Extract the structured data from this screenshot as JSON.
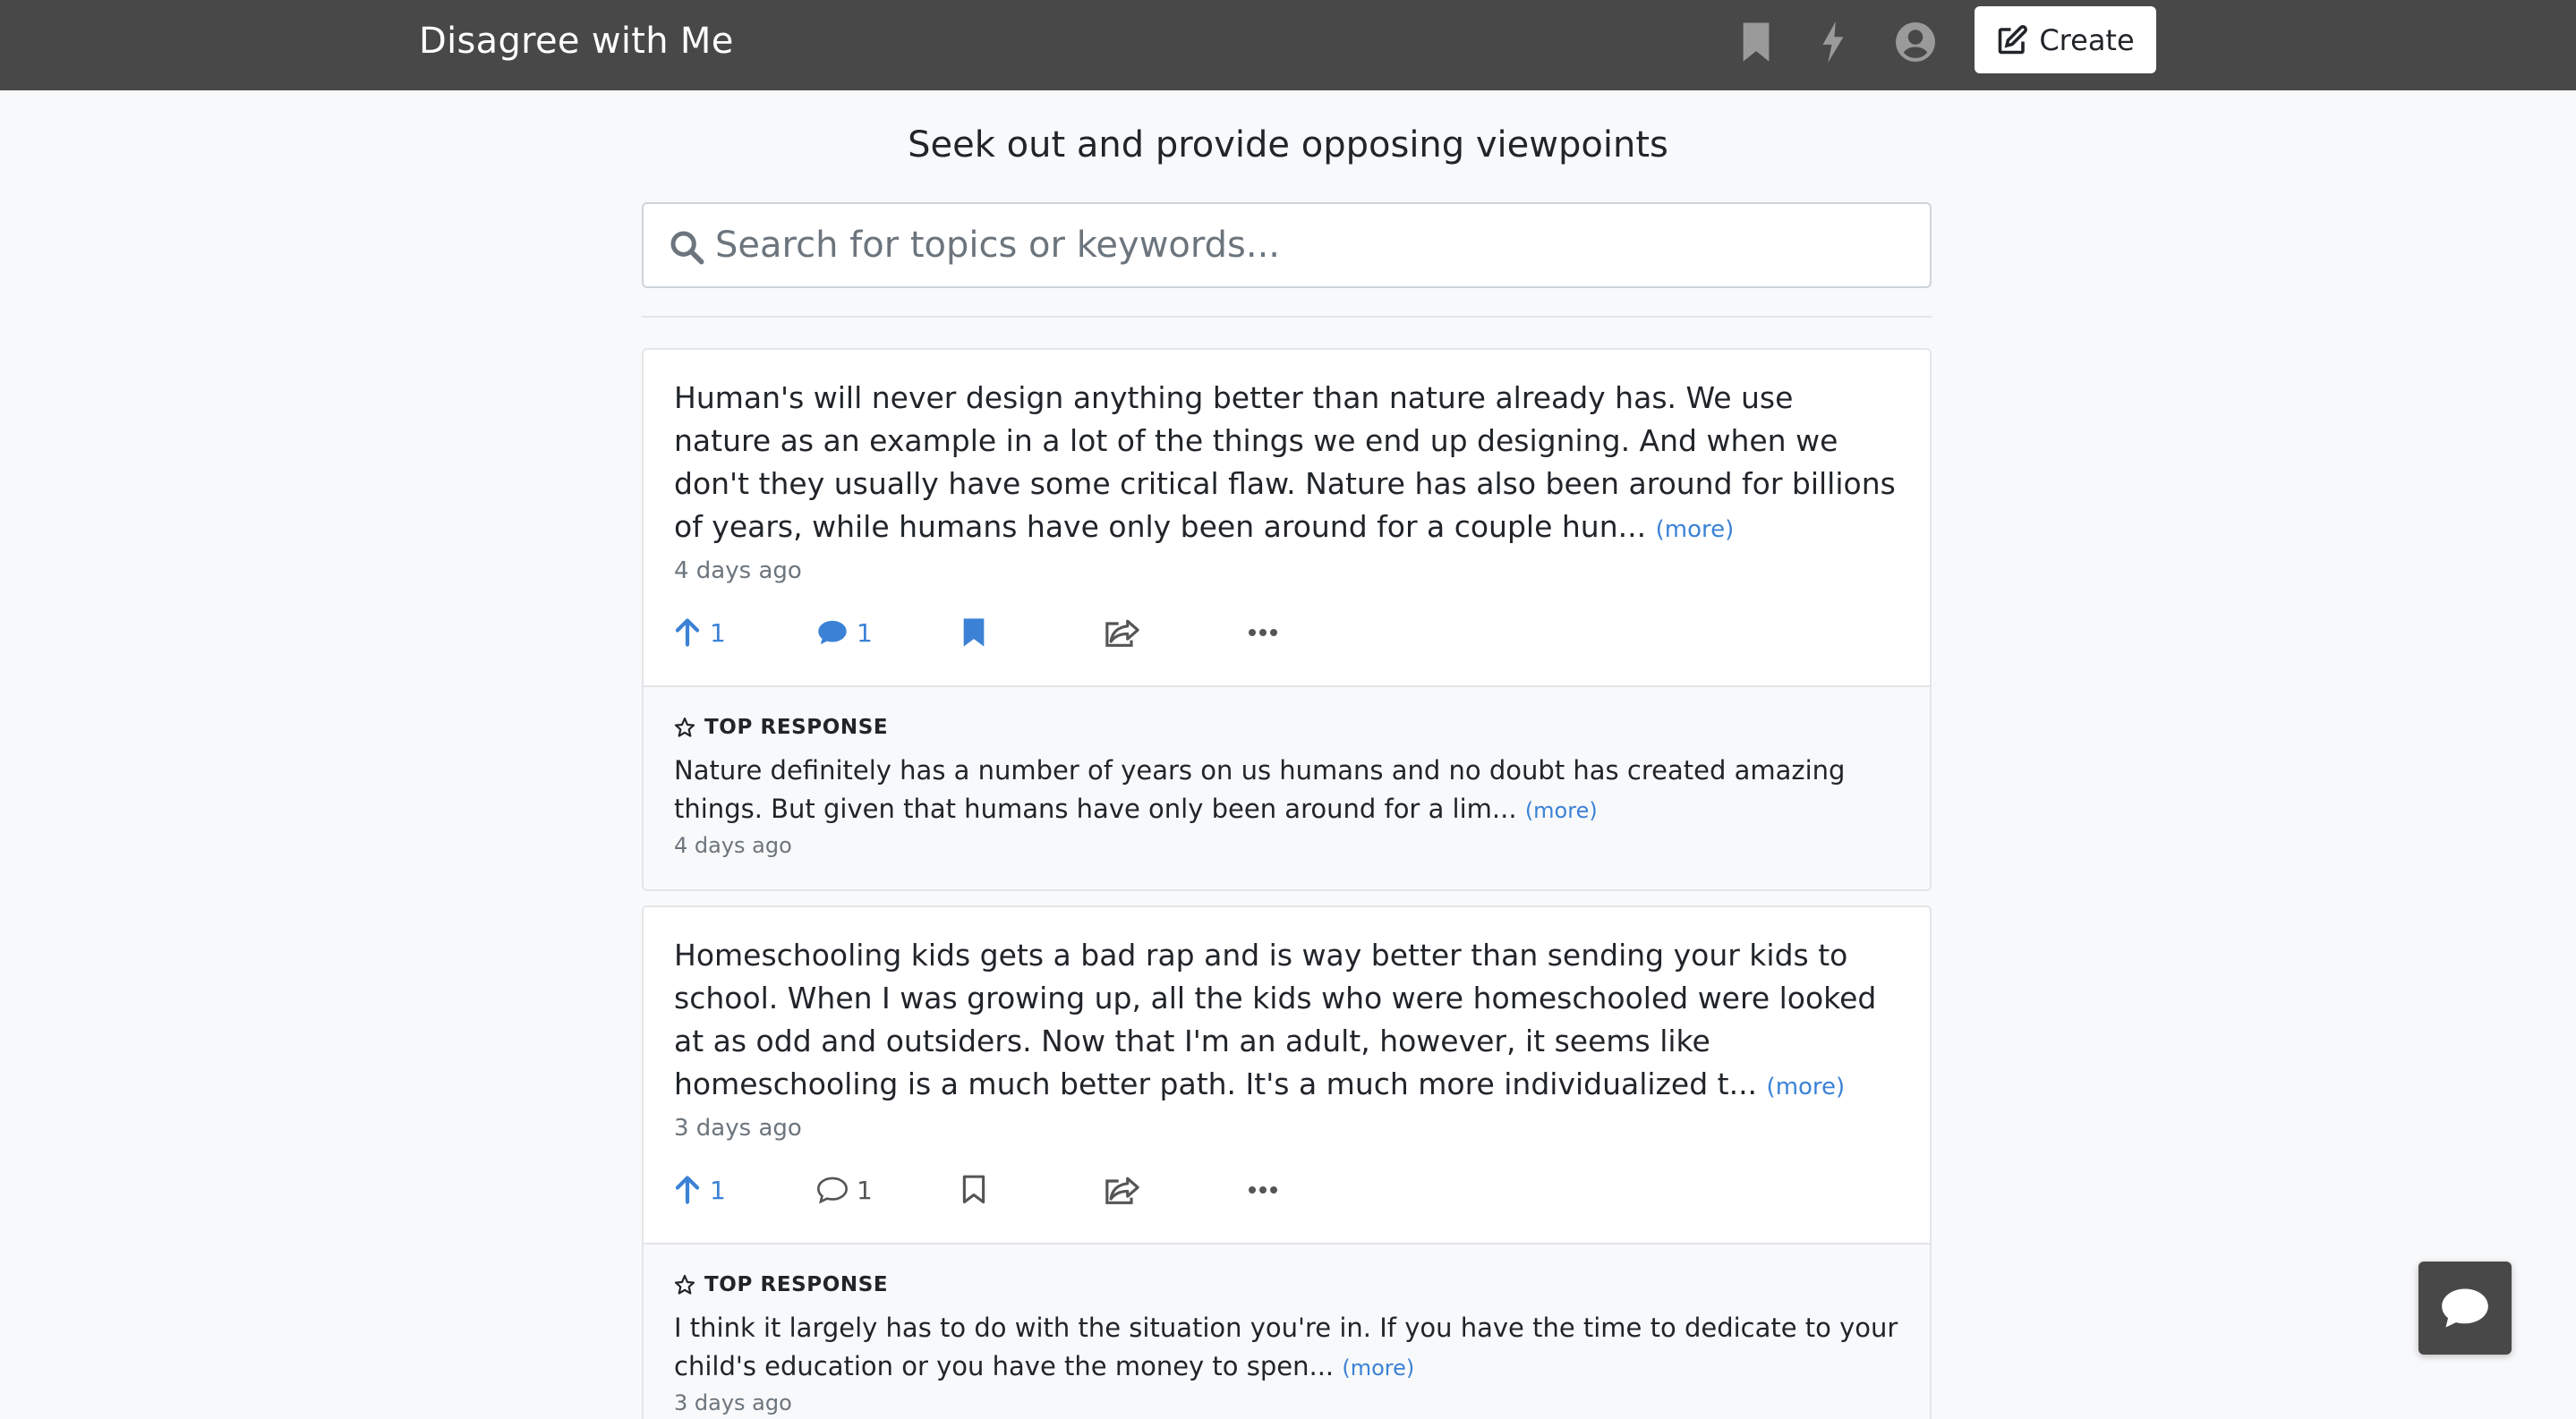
{
  "app": {
    "title": "Disagree with Me",
    "tagline": "Seek out and provide opposing viewpoints"
  },
  "nav": {
    "icons": [
      "bookmark-icon",
      "bolt-icon",
      "user-circle-icon"
    ],
    "create_label": "Create"
  },
  "search": {
    "placeholder": "Search for topics or keywords..."
  },
  "more_label": "(more)",
  "top_response_label": "TOP RESPONSE",
  "posts": [
    {
      "text": "Human's will never design anything better than nature already has. We use nature as an example in a lot of the things we end up designing. And when we don't they usually have some critical flaw. Nature has also been around for billions of years, while humans have only been around for a couple hun...",
      "time": "4 days ago",
      "upvotes": "1",
      "comments": "1",
      "bookmarked": true,
      "commented": true,
      "response": {
        "text": "Nature definitely has a number of years on us humans and no doubt has created amazing things. But given that humans have only been around for a lim...",
        "time": "4 days ago"
      }
    },
    {
      "text": "Homeschooling kids gets a bad rap and is way better than sending your kids to school. When I was growing up, all the kids who were homeschooled were looked at as odd and outsiders. Now that I'm an adult, however, it seems like homeschooling is a much better path. It's a much more individualized t...",
      "time": "3 days ago",
      "upvotes": "1",
      "comments": "1",
      "bookmarked": false,
      "commented": false,
      "response": {
        "text": "I think it largely has to do with the situation you're in. If you have the time to dedicate to your child's education or you have the money to spen...",
        "time": "3 days ago"
      }
    }
  ],
  "colors": {
    "navbar": "#484848",
    "accent": "#3b82d6",
    "background": "#f8f9fa"
  }
}
